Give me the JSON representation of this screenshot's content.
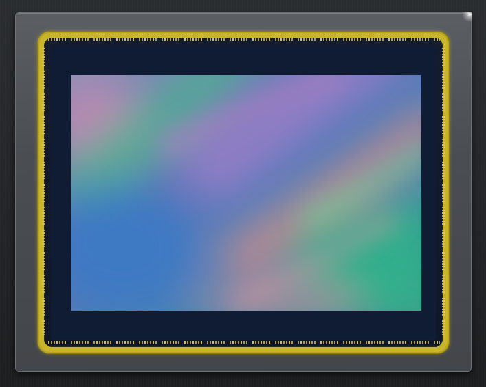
{
  "scene": {
    "subject": "image-sensor",
    "colors": {
      "background": "#26282a",
      "package": "#4d5155",
      "gold_ring": "#c9b52c",
      "die": "#0f1c33",
      "pads": "#d9c56a"
    },
    "iridescent_colors": [
      "#b07bb0",
      "#6f86c6",
      "#3f7bc4",
      "#2fa890",
      "#d07f9a",
      "#9b86c9",
      "#4cbf8a"
    ]
  }
}
